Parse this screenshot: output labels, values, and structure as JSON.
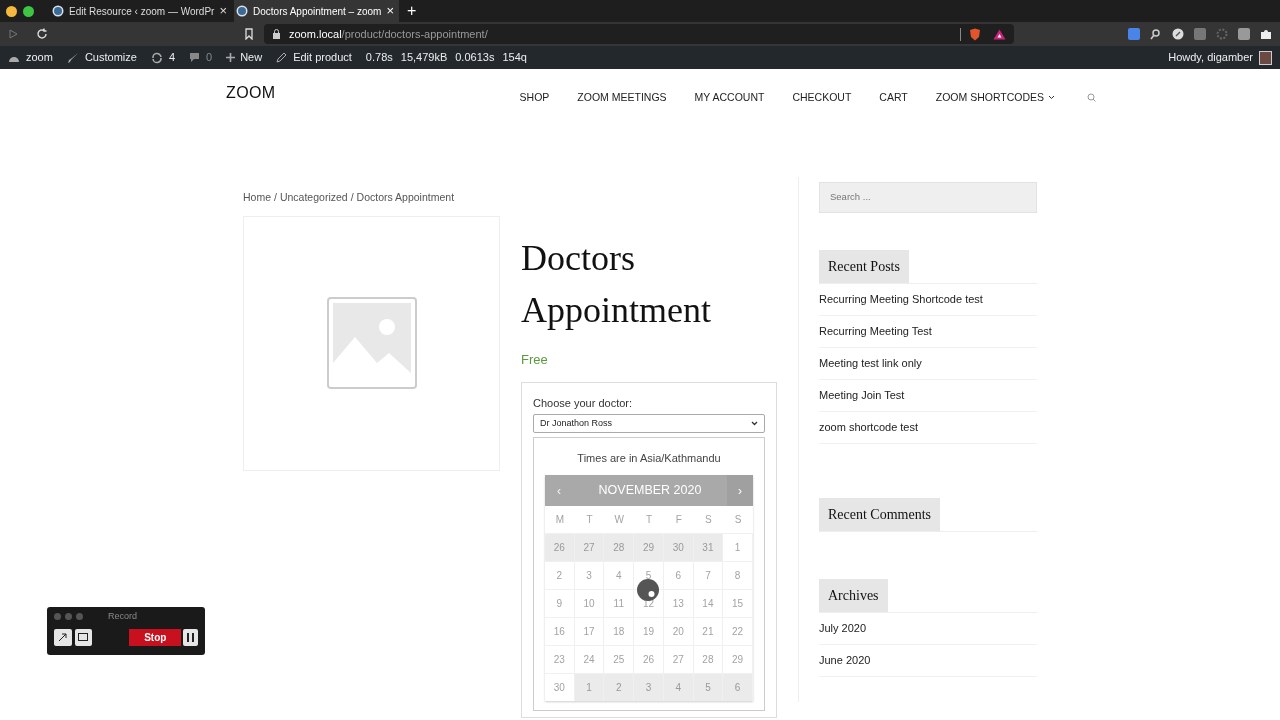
{
  "browser": {
    "tabs": [
      {
        "title": "Edit Resource ‹ zoom — WordPr",
        "close": "×",
        "selected": false
      },
      {
        "title": "Doctors Appointment – zoom",
        "close": "×",
        "selected": true
      }
    ],
    "new_tab": "+",
    "url_host": "zoom.local",
    "url_path": "/product/doctors-appointment/"
  },
  "admin_bar": {
    "site": "zoom",
    "customize": "Customize",
    "updates": "4",
    "comments": "0",
    "new": "New",
    "edit": "Edit product",
    "stats": [
      "0.78s",
      "15,479kB",
      "0.0613s",
      "154q"
    ],
    "greeting": "Howdy, digamber"
  },
  "site": {
    "logo": "ZOOM",
    "nav": [
      {
        "label": "SHOP",
        "dropdown": false
      },
      {
        "label": "ZOOM MEETINGS",
        "dropdown": false
      },
      {
        "label": "MY ACCOUNT",
        "dropdown": false
      },
      {
        "label": "CHECKOUT",
        "dropdown": false
      },
      {
        "label": "CART",
        "dropdown": false
      },
      {
        "label": "ZOOM SHORTCODES",
        "dropdown": true
      }
    ]
  },
  "breadcrumb": {
    "separator": "/",
    "items": [
      "Home",
      "Uncategorized",
      "Doctors Appointment"
    ]
  },
  "product": {
    "title": "Doctors Appointment",
    "price": "Free",
    "doctor_label": "Choose your doctor:",
    "doctor": "Dr Jonathon Ross",
    "timezone": "Times are in Asia/Kathmandu",
    "calendar": {
      "prev": "‹",
      "month": "NOVEMBER 2020",
      "next": "›",
      "weekdays": [
        "M",
        "T",
        "W",
        "T",
        "F",
        "S",
        "S"
      ],
      "days": [
        {
          "d": "26",
          "outside": true
        },
        {
          "d": "27",
          "outside": true
        },
        {
          "d": "28",
          "outside": true
        },
        {
          "d": "29",
          "outside": true
        },
        {
          "d": "30",
          "outside": true
        },
        {
          "d": "31",
          "outside": true
        },
        {
          "d": "1",
          "outside": false
        },
        {
          "d": "2",
          "outside": false
        },
        {
          "d": "3",
          "outside": false
        },
        {
          "d": "4",
          "outside": false
        },
        {
          "d": "5",
          "outside": false
        },
        {
          "d": "6",
          "outside": false
        },
        {
          "d": "7",
          "outside": false
        },
        {
          "d": "8",
          "outside": false
        },
        {
          "d": "9",
          "outside": false
        },
        {
          "d": "10",
          "outside": false
        },
        {
          "d": "11",
          "outside": false
        },
        {
          "d": "12",
          "outside": false
        },
        {
          "d": "13",
          "outside": false
        },
        {
          "d": "14",
          "outside": false
        },
        {
          "d": "15",
          "outside": false
        },
        {
          "d": "16",
          "outside": false
        },
        {
          "d": "17",
          "outside": false
        },
        {
          "d": "18",
          "outside": false
        },
        {
          "d": "19",
          "outside": false
        },
        {
          "d": "20",
          "outside": false
        },
        {
          "d": "21",
          "outside": false
        },
        {
          "d": "22",
          "outside": false
        },
        {
          "d": "23",
          "outside": false
        },
        {
          "d": "24",
          "outside": false
        },
        {
          "d": "25",
          "outside": false
        },
        {
          "d": "26",
          "outside": false
        },
        {
          "d": "27",
          "outside": false
        },
        {
          "d": "28",
          "outside": false
        },
        {
          "d": "29",
          "outside": false
        },
        {
          "d": "30",
          "outside": false
        },
        {
          "d": "1",
          "outside": true
        },
        {
          "d": "2",
          "outside": true
        },
        {
          "d": "3",
          "outside": true
        },
        {
          "d": "4",
          "outside": true
        },
        {
          "d": "5",
          "outside": true
        },
        {
          "d": "6",
          "outside": true
        }
      ]
    }
  },
  "sidebar": {
    "search_placeholder": "Search ...",
    "widgets": [
      {
        "title": "Recent Posts",
        "items": [
          "Recurring Meeting Shortcode test",
          "Recurring Meeting Test",
          "Meeting test link only",
          "Meeting Join Test",
          "zoom shortcode test"
        ]
      },
      {
        "title": "Recent Comments"
      },
      {
        "title": "Archives",
        "items": [
          "July 2020",
          "June 2020"
        ]
      }
    ]
  },
  "recorder": {
    "title": "Record",
    "stop": "Stop"
  }
}
